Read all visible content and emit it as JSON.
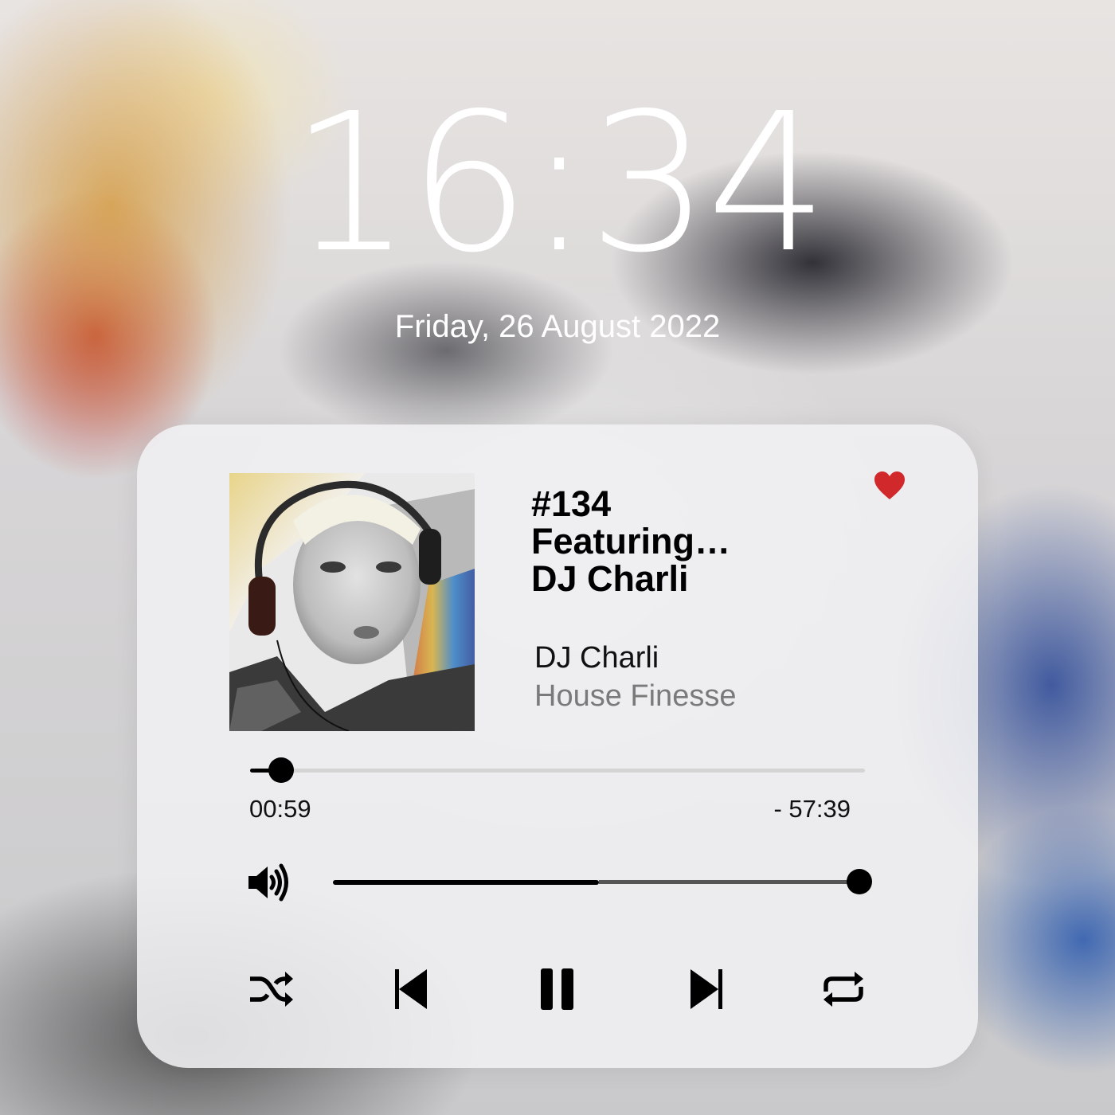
{
  "lock_screen": {
    "time": "16:34",
    "date": "Friday, 26 August 2022"
  },
  "now_playing": {
    "title_lines": [
      "#134",
      "Featuring…",
      "DJ Charli"
    ],
    "artist": "DJ Charli",
    "album": "House Finesse",
    "favorited": true,
    "heart_color": "#d0282b"
  },
  "playback": {
    "elapsed": "00:59",
    "remaining": "- 57:39",
    "progress_fraction": 0.05
  },
  "volume": {
    "level_fraction": 0.99,
    "secondary_fraction": 0.5
  },
  "controls": {
    "shuffle_icon": "shuffle-icon",
    "previous_icon": "previous-track-icon",
    "play_state_icon": "pause-icon",
    "next_icon": "next-track-icon",
    "repeat_icon": "repeat-icon"
  }
}
